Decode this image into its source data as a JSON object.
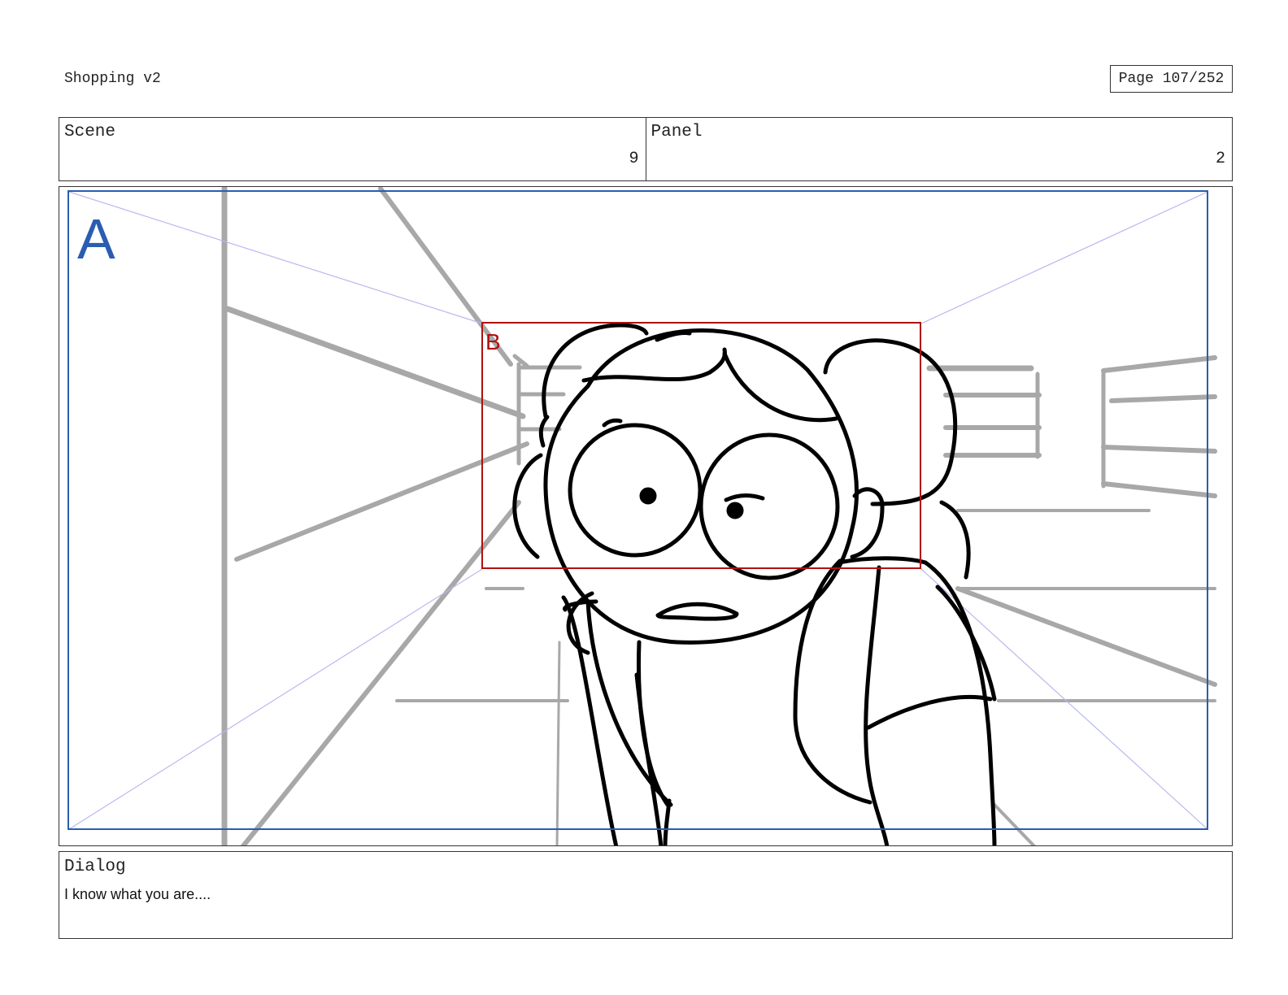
{
  "header": {
    "project_title": "Shopping v2",
    "page_indicator": "Page 107/252"
  },
  "info": {
    "scene_label": "Scene",
    "scene_value": "9",
    "panel_label": "Panel",
    "panel_value": "2"
  },
  "panel": {
    "frame_a_label": "A",
    "frame_b_label": "B",
    "frame_a_color": "#2a5db0",
    "frame_b_color": "#b01010",
    "background_line_color": "#a8a8a8",
    "character_line_color": "#000000"
  },
  "dialog": {
    "label": "Dialog",
    "text": "I know what you are...."
  }
}
